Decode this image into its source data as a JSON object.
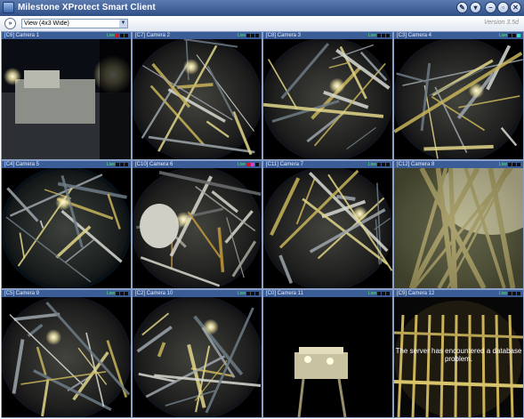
{
  "window": {
    "title": "Milestone XProtect Smart Client",
    "version": "Version 3.5d"
  },
  "toolbar": {
    "nav_icon": "double-chevron-right-icon",
    "view_select_value": "View (4x3 Wide)"
  },
  "title_buttons": [
    {
      "name": "settings-button",
      "icon": "wrench-icon",
      "glyph": "✎"
    },
    {
      "name": "help-button",
      "icon": "question-icon",
      "glyph": "▾"
    },
    {
      "name": "minimize-button",
      "icon": "minimize-icon",
      "glyph": "–"
    },
    {
      "name": "maximize-button",
      "icon": "maximize-icon",
      "glyph": "▫"
    },
    {
      "name": "close-button",
      "icon": "close-icon",
      "glyph": "✕"
    }
  ],
  "cameras": [
    {
      "label": "[C6] Camera 1",
      "status": "Live",
      "indicators": [
        "#d01818",
        "#101010",
        "#101010"
      ],
      "scene": "floodlit"
    },
    {
      "label": "[C7] Camera 2",
      "status": "Live",
      "indicators": [
        "#101010",
        "#101010",
        "#101010"
      ],
      "scene": "fisheye"
    },
    {
      "label": "[C8] Camera 3",
      "status": "Live",
      "indicators": [
        "#101010",
        "#101010",
        "#101010"
      ],
      "scene": "fisheye"
    },
    {
      "label": "[C3] Camera 4",
      "status": "Live",
      "indicators": [
        "#101010",
        "#101010",
        "#2ee0b0"
      ],
      "scene": "fisheye"
    },
    {
      "label": "[C4] Camera 5",
      "status": "Live",
      "indicators": [
        "#101010",
        "#101010",
        "#101010"
      ],
      "scene": "dark"
    },
    {
      "label": "[C10] Camera 6",
      "status": "Live",
      "indicators": [
        "#d01818",
        "#d63fd6",
        "#101010"
      ],
      "scene": "pipes"
    },
    {
      "label": "[C11] Camera 7",
      "status": "Live",
      "indicators": [
        "#101010",
        "#101010",
        "#101010"
      ],
      "scene": "fisheye"
    },
    {
      "label": "[C12] Camera 8",
      "status": "Live",
      "indicators": [
        "#101010",
        "#101010",
        "#101010"
      ],
      "scene": "bright"
    },
    {
      "label": "[C5] Camera 9",
      "status": "Live",
      "indicators": [
        "#101010",
        "#101010",
        "#101010"
      ],
      "scene": "fisheye"
    },
    {
      "label": "[C2] Camera 10",
      "status": "Live",
      "indicators": [
        "#101010",
        "#101010",
        "#101010"
      ],
      "scene": "fisheye"
    },
    {
      "label": "[C0] Camera 11",
      "status": "Live",
      "indicators": [
        "#101010",
        "#101010",
        "#101010"
      ],
      "scene": "night"
    },
    {
      "label": "[C9] Camera 12",
      "status": "Live",
      "indicators": [
        "#101010",
        "#101010",
        "#101010"
      ],
      "scene": "error",
      "overlay_message": "The server has encountered a database problem."
    }
  ]
}
